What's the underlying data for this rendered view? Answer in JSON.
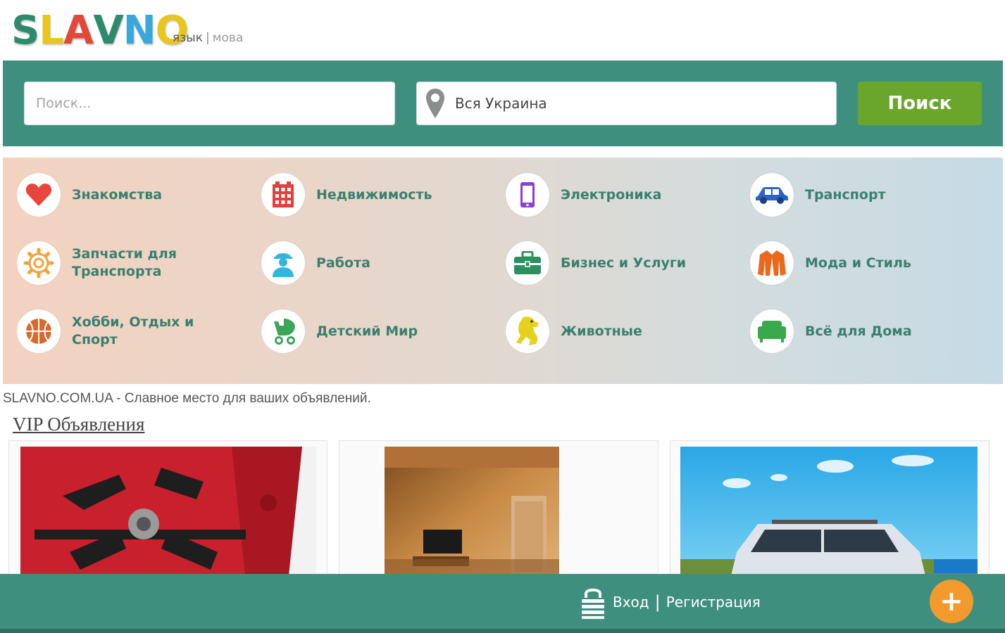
{
  "header": {
    "logo_letters": [
      "S",
      "L",
      "A",
      "V",
      "N",
      "O"
    ],
    "logo_colors": [
      "#2f8a6d",
      "#e9c61d",
      "#e0493a",
      "#2f8a6d",
      "#3ba7d8",
      "#e9c61d"
    ],
    "lang_label": "язык",
    "lang_sep": "|",
    "lang_alt": "мова"
  },
  "search": {
    "placeholder": "Поиск...",
    "location": "Вся Украина",
    "button_label": "Поиск"
  },
  "categories": [
    {
      "label": "Знакомства",
      "icon": "heart-icon",
      "color": "#e8453c"
    },
    {
      "label": "Недвижимость",
      "icon": "building-icon",
      "color": "#e0413f"
    },
    {
      "label": "Электроника",
      "icon": "smartphone-icon",
      "color": "#8a3fd1"
    },
    {
      "label": "Транспорт",
      "icon": "car-icon",
      "color": "#2b63c8"
    },
    {
      "label": "Запчасти для Транспорта",
      "icon": "gear-icon",
      "color": "#f2a33a"
    },
    {
      "label": "Работа",
      "icon": "worker-icon",
      "color": "#35b5de"
    },
    {
      "label": "Бизнес и Услуги",
      "icon": "briefcase-icon",
      "color": "#2b8f5f"
    },
    {
      "label": "Мода и Стиль",
      "icon": "jacket-icon",
      "color": "#e96a1c"
    },
    {
      "label": "Хобби, Отдых и Спорт",
      "icon": "basketball-icon",
      "color": "#d9682a"
    },
    {
      "label": "Детский Мир",
      "icon": "stroller-icon",
      "color": "#3aa65a"
    },
    {
      "label": "Животные",
      "icon": "dog-icon",
      "color": "#e6d21c"
    },
    {
      "label": "Всё для Дома",
      "icon": "sofa-icon",
      "color": "#3aa84d"
    }
  ],
  "tagline": "SLAVNO.COM.UA - Славное место для ваших объявлений.",
  "vip": {
    "title": "VIP Объявления"
  },
  "footer": {
    "login": "Вход",
    "divider": "|",
    "register": "Регистрация",
    "add_symbol": "+"
  }
}
